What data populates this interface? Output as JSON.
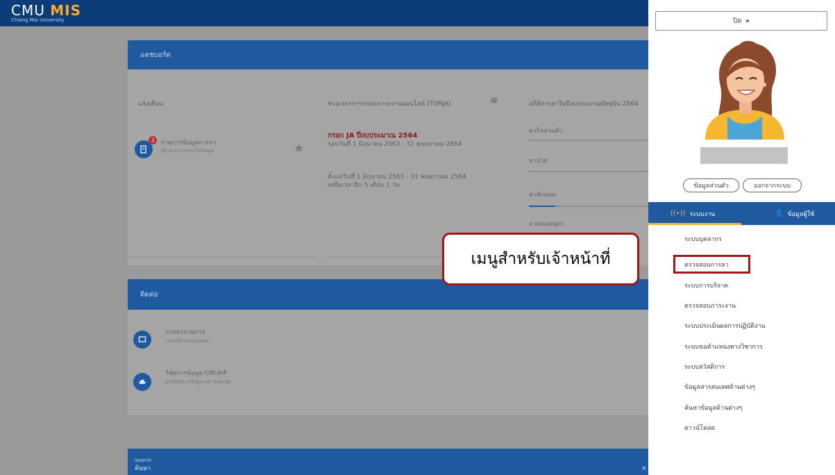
{
  "app": {
    "logo_cmu": "CMU",
    "logo_mis": "MIS",
    "logo_sub": "Chiang Mai University"
  },
  "dashboard": {
    "header": "แดชบอร์ด",
    "notify_title": "แจ้งเตือน",
    "notify_item_title": "รายการข้อมูลการลา",
    "notify_item_sub": "ผู้ลาคาดว่าจะแก้ไขข้อมูล",
    "notify_badge": "3",
    "tor_title": "ช่วงเวลาการกรอกภาระงานออนไลน์ (TORJA)",
    "tor_red": "กรอก JA ปีงบประมาณ 2564",
    "tor_line1": "รอบวันที่ 1 มิถุนายน 2563 - 31 พฤษภาคม 2564",
    "tor_line2": "ตั้งแต่วันที่ 1 มิถุนายน 2563 - 31 พฤษภาคม 2564",
    "tor_line3": "เหลือเวลาอีก 5 เดือน 1 วัน",
    "leave_title": "สถิติการลาในปีงบประมาณปัจจุบัน 2564",
    "leave_items": [
      "ลากิจส่วนตัว",
      "ลาป่วย",
      "ลาพักผ่อน",
      "ลาคลอดบุตร"
    ]
  },
  "contact": {
    "header": "ติดต่อ",
    "item1_title": "การลาราชการ",
    "item1_sub": "งานบริหารงานบุคคล",
    "item2_title": "วิจัยการข้อมูล CMUHF",
    "item2_sub": "ฝ่ายวิจัยการข้อมูล มหาวิทยาลัย"
  },
  "bottom": {
    "label1": "Search",
    "label2": "ค้นหา"
  },
  "sidebar": {
    "close_label": "ปิด",
    "profile_button": "ข้อมูลส่วนตัว",
    "logout_button": "ออกจากระบบ",
    "tab_systems": "ระบบงาน",
    "tab_profile": "ข้อมูลผู้ใช้",
    "menu": [
      "ระบบบุคลากร",
      "ตรวจสอบการลา",
      "ระบบการบริจาค",
      "ตรวจสอบภาระงาน",
      "ระบบประเมินผลการปฏิบัติงาน",
      "ระบบขอตำแหน่งทางวิชาการ",
      "ระบบสวัสดิการ",
      "ข้อมูลสารสนเทศด้านต่างๆ",
      "ค้นหาข้อมูลด้านต่างๆ",
      "ดาวน์โหลด"
    ]
  },
  "annotation": {
    "callout_text": "เมนูสำหรับเจ้าหน้าที่"
  },
  "colors": {
    "primary": "#1f5aa1",
    "topbar": "#0d3d78",
    "annotation_red": "#a0161b",
    "overlay_grey": "#9a9a9a"
  }
}
